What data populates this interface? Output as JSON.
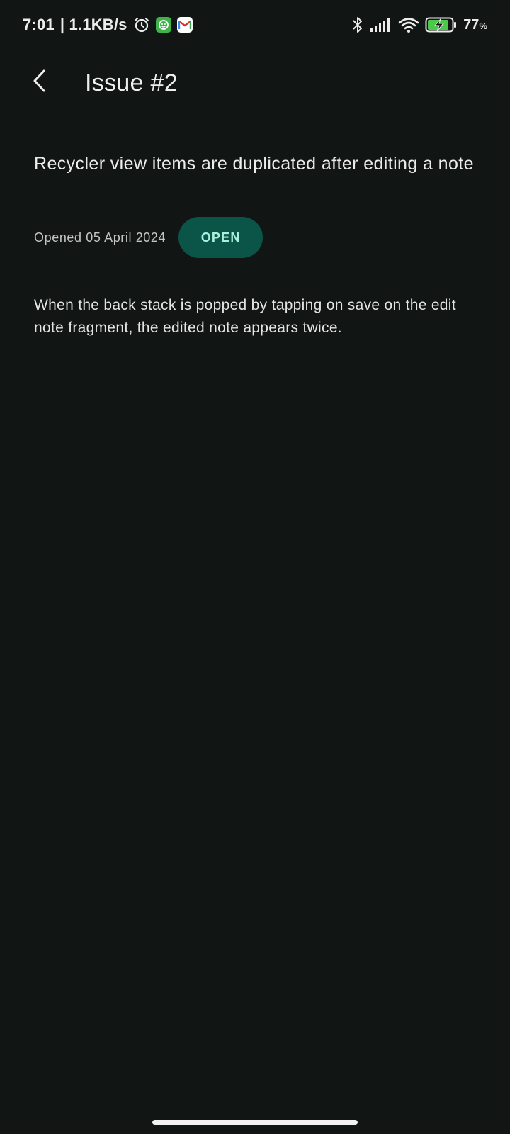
{
  "status_bar": {
    "time": "7:01",
    "network_speed": "| 1.1KB/s",
    "battery_percent": "77",
    "battery_unit": "%",
    "icons": [
      "alarm-icon",
      "app-notification-icon",
      "gmail-icon",
      "bluetooth-icon",
      "signal-icon",
      "wifi-icon",
      "battery-charging-icon"
    ]
  },
  "app_bar": {
    "title": "Issue #2",
    "back_icon": "chevron-left-icon"
  },
  "issue": {
    "title": "Recycler view items are duplicated after editing a note",
    "opened": "Opened 05 April 2024",
    "status": "OPEN",
    "body": "When the back stack is popped by tapping on save on the edit note fragment, the edited note appears twice."
  },
  "colors": {
    "background": "#111514",
    "status_chip_bg": "#0b5448",
    "status_chip_text": "#a9f0dc",
    "divider": "#4a4d4c"
  }
}
